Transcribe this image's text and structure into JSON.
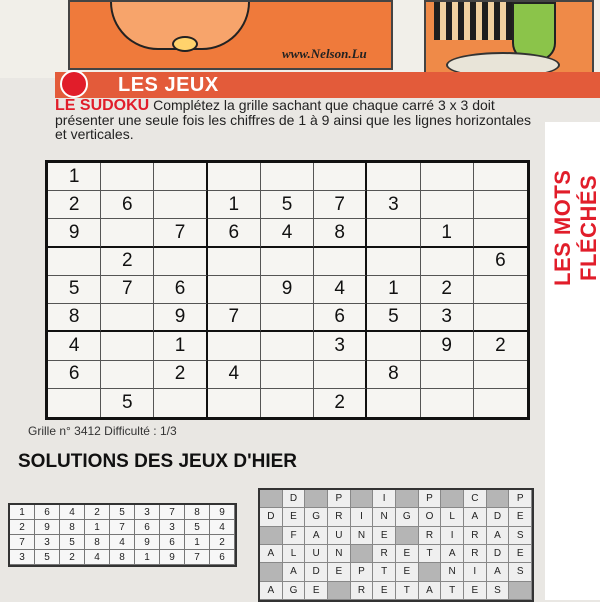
{
  "comic": {
    "url": "www.Nelson.Lu"
  },
  "section": {
    "title": "LES JEUX"
  },
  "sudoku_intro": {
    "keyword": "LE SUDOKU",
    "text": " Complétez la grille sachant que chaque carré 3 x 3 doit présenter une seule fois les chiffres de 1 à 9 ainsi que les lignes horizontales et verticales."
  },
  "sudoku": {
    "rows": [
      [
        "1",
        "",
        "",
        "",
        "",
        "",
        "",
        "",
        ""
      ],
      [
        "2",
        "6",
        "",
        "1",
        "5",
        "7",
        "3",
        "",
        ""
      ],
      [
        "9",
        "",
        "7",
        "6",
        "4",
        "8",
        "",
        "1",
        ""
      ],
      [
        "",
        "2",
        "",
        "",
        "",
        "",
        "",
        "",
        "6"
      ],
      [
        "5",
        "7",
        "6",
        "",
        "9",
        "4",
        "1",
        "2",
        ""
      ],
      [
        "8",
        "",
        "9",
        "7",
        "",
        "6",
        "5",
        "3",
        ""
      ],
      [
        "4",
        "",
        "1",
        "",
        "",
        "3",
        "",
        "9",
        "2"
      ],
      [
        "6",
        "",
        "2",
        "4",
        "",
        "",
        "8",
        "",
        ""
      ],
      [
        "",
        "5",
        "",
        "",
        "",
        "2",
        "",
        "",
        ""
      ]
    ]
  },
  "grid_info": "Grille n° 3412  Difficulté : 1/3",
  "side_title": "LES MOTS FLÉCHÉS",
  "solutions": {
    "title": "SOLUTIONS DES JEUX D'HIER",
    "sudoku_rows": [
      [
        "1",
        "6",
        "4",
        "2",
        "5",
        "3",
        "7",
        "8",
        "9"
      ],
      [
        "2",
        "9",
        "8",
        "1",
        "7",
        "6",
        "3",
        "5",
        "4"
      ],
      [
        "7",
        "3",
        "5",
        "8",
        "4",
        "9",
        "6",
        "1",
        "2"
      ],
      [
        "3",
        "5",
        "2",
        "4",
        "8",
        "1",
        "9",
        "7",
        "6"
      ]
    ],
    "arrows_rows": [
      [
        "",
        "D",
        "",
        "P",
        "",
        "I",
        "",
        "P",
        "",
        "C",
        "",
        "P"
      ],
      [
        "D",
        "E",
        "G",
        "R",
        "I",
        "N",
        "G",
        "O",
        "L",
        "A",
        "D",
        "E"
      ],
      [
        "",
        "F",
        "A",
        "U",
        "N",
        "E",
        "",
        "R",
        "I",
        "R",
        "A",
        "S"
      ],
      [
        "A",
        "L",
        "U",
        "N",
        "",
        "R",
        "E",
        "T",
        "A",
        "R",
        "D",
        "E"
      ],
      [
        "",
        "A",
        "D",
        "E",
        "P",
        "T",
        "E",
        "",
        "N",
        "I",
        "A",
        "S"
      ],
      [
        "A",
        "G",
        "E",
        "",
        "R",
        "E",
        "T",
        "A",
        "T",
        "E",
        "S",
        ""
      ]
    ]
  }
}
